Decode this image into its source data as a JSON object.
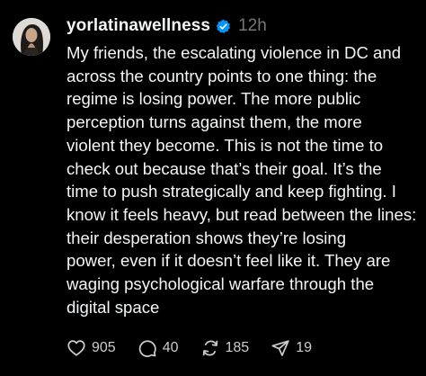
{
  "post": {
    "username": "yorlatinawellness",
    "timestamp": "12h",
    "lines": [
      "My friends, the escalating violence in DC and",
      "across the country points to one thing: the",
      "regime is losing power. The more public",
      "perception turns against them, the more",
      "violent they become. This is not the time to",
      "check out because that’s their goal. It’s the",
      "time to push strategically and keep fighting. I",
      "know it feels heavy, but read between the lines:",
      "their desperation shows they’re losing",
      "power, even if it doesn’t feel like it. They are",
      "waging psychological warfare through the",
      "digital space"
    ],
    "actions": {
      "likes": "905",
      "replies": "40",
      "reposts": "185",
      "shares": "19"
    }
  },
  "icons": {
    "verified": "verified-badge-icon",
    "like": "heart-icon",
    "reply": "speech-bubble-icon",
    "repost": "repost-arrows-icon",
    "share": "paper-plane-icon"
  },
  "colors": {
    "background": "#000000",
    "text": "#f3f5f7",
    "muted": "#777777",
    "verified": "#0095f6"
  }
}
